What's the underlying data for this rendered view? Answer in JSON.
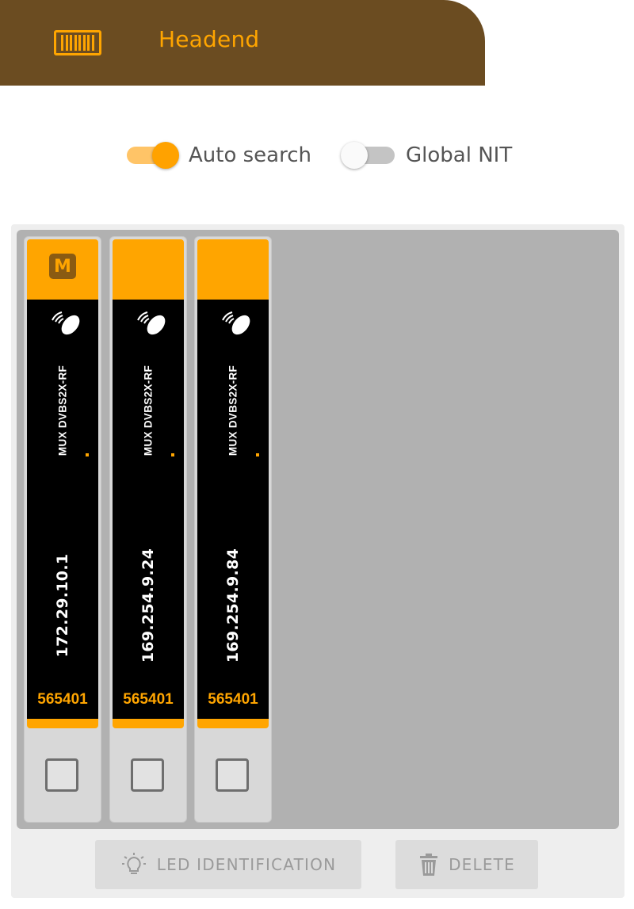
{
  "header": {
    "title": "Headend",
    "icon": "rack-module-icon",
    "background_color": "#6b4c21",
    "accent_color": "#ffa500"
  },
  "toggles": {
    "auto_search": {
      "label": "Auto search",
      "on": true
    },
    "global_nit": {
      "label": "Global NIT",
      "on": false
    }
  },
  "modules": [
    {
      "badge": "M",
      "name": "MUX DVBS2X-RF",
      "ip": "172.29.10.1",
      "serial": "565401",
      "checked": false
    },
    {
      "badge": "",
      "name": "MUX DVBS2X-RF",
      "ip": "169.254.9.24",
      "serial": "565401",
      "checked": false
    },
    {
      "badge": "",
      "name": "MUX DVBS2X-RF",
      "ip": "169.254.9.84",
      "serial": "565401",
      "checked": false
    }
  ],
  "buttons": {
    "led_identification": {
      "label": "LED IDENTIFICATION",
      "icon": "lightbulb-icon",
      "enabled": false
    },
    "delete": {
      "label": "DELETE",
      "icon": "trash-icon",
      "enabled": false
    }
  }
}
